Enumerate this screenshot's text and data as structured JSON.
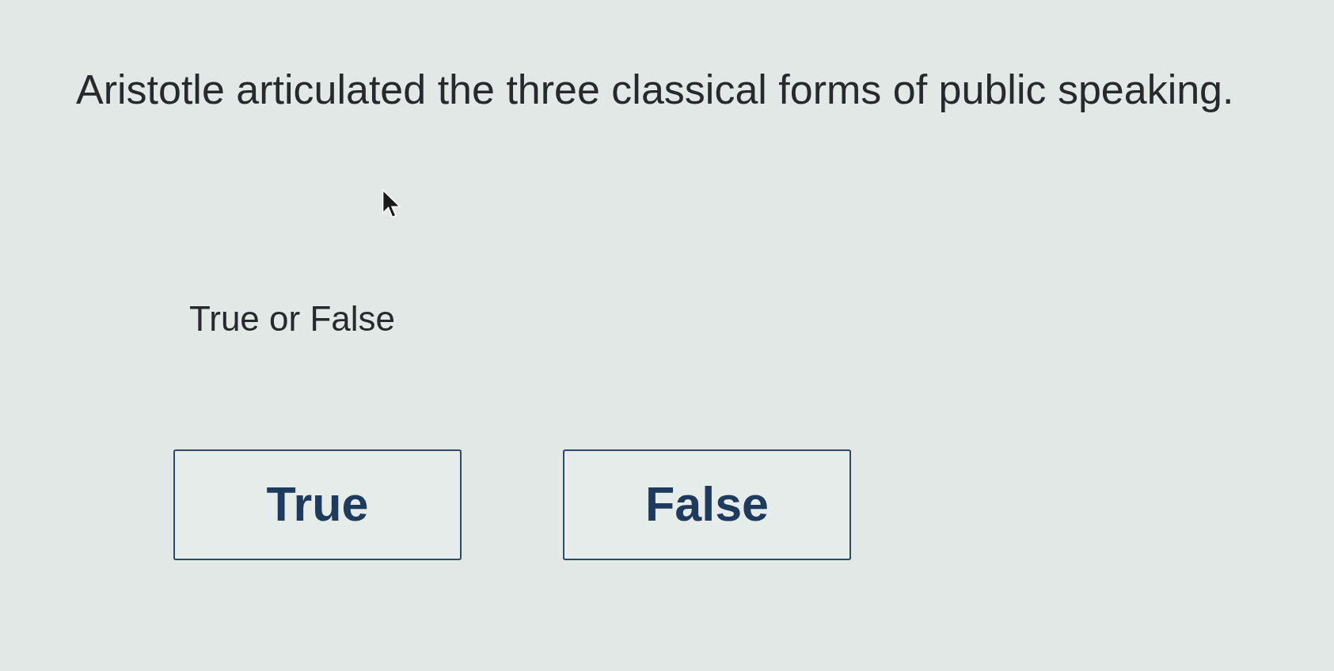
{
  "question": {
    "text": "Aristotle articulated the three classical forms of public speaking."
  },
  "prompt": {
    "text": "True or False"
  },
  "options": [
    {
      "label": "True",
      "selected": false
    },
    {
      "label": "False",
      "selected": false
    }
  ]
}
